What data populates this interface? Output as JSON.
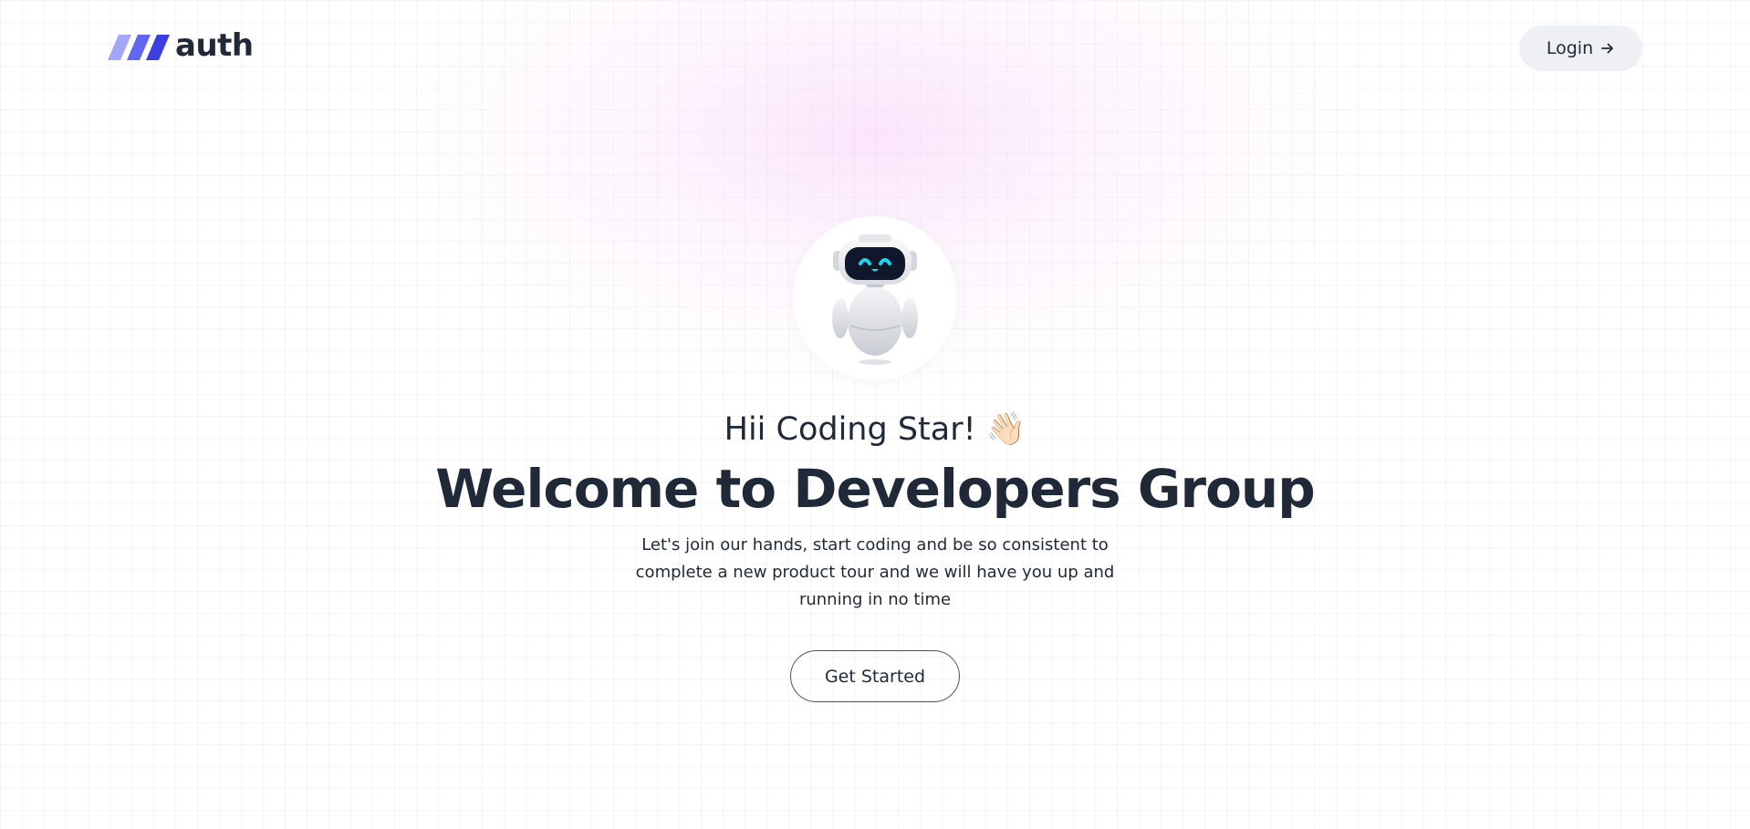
{
  "brand": {
    "name": "auth",
    "logo_icon": "slanted-bars-logo",
    "logo_colors": [
      "#8b8cf7",
      "#6366f1",
      "#3b3fe0"
    ]
  },
  "header": {
    "login_label": "Login",
    "login_icon": "arrow-right-icon"
  },
  "hero": {
    "avatar_icon": "robot-mascot",
    "greeting": "Hii Coding Star! 👋🏻",
    "title": "Welcome to Developers Group",
    "description": "Let's join our hands, start coding and be so consistent to complete a new product tour and we will have you up and running in no time",
    "cta_label": "Get Started"
  },
  "colors": {
    "text": "#1f2937",
    "login_bg": "#eef0f3",
    "glow": "#f6c4f6",
    "robot_visor": "#0f172a",
    "robot_eyes": "#22d3ee"
  }
}
